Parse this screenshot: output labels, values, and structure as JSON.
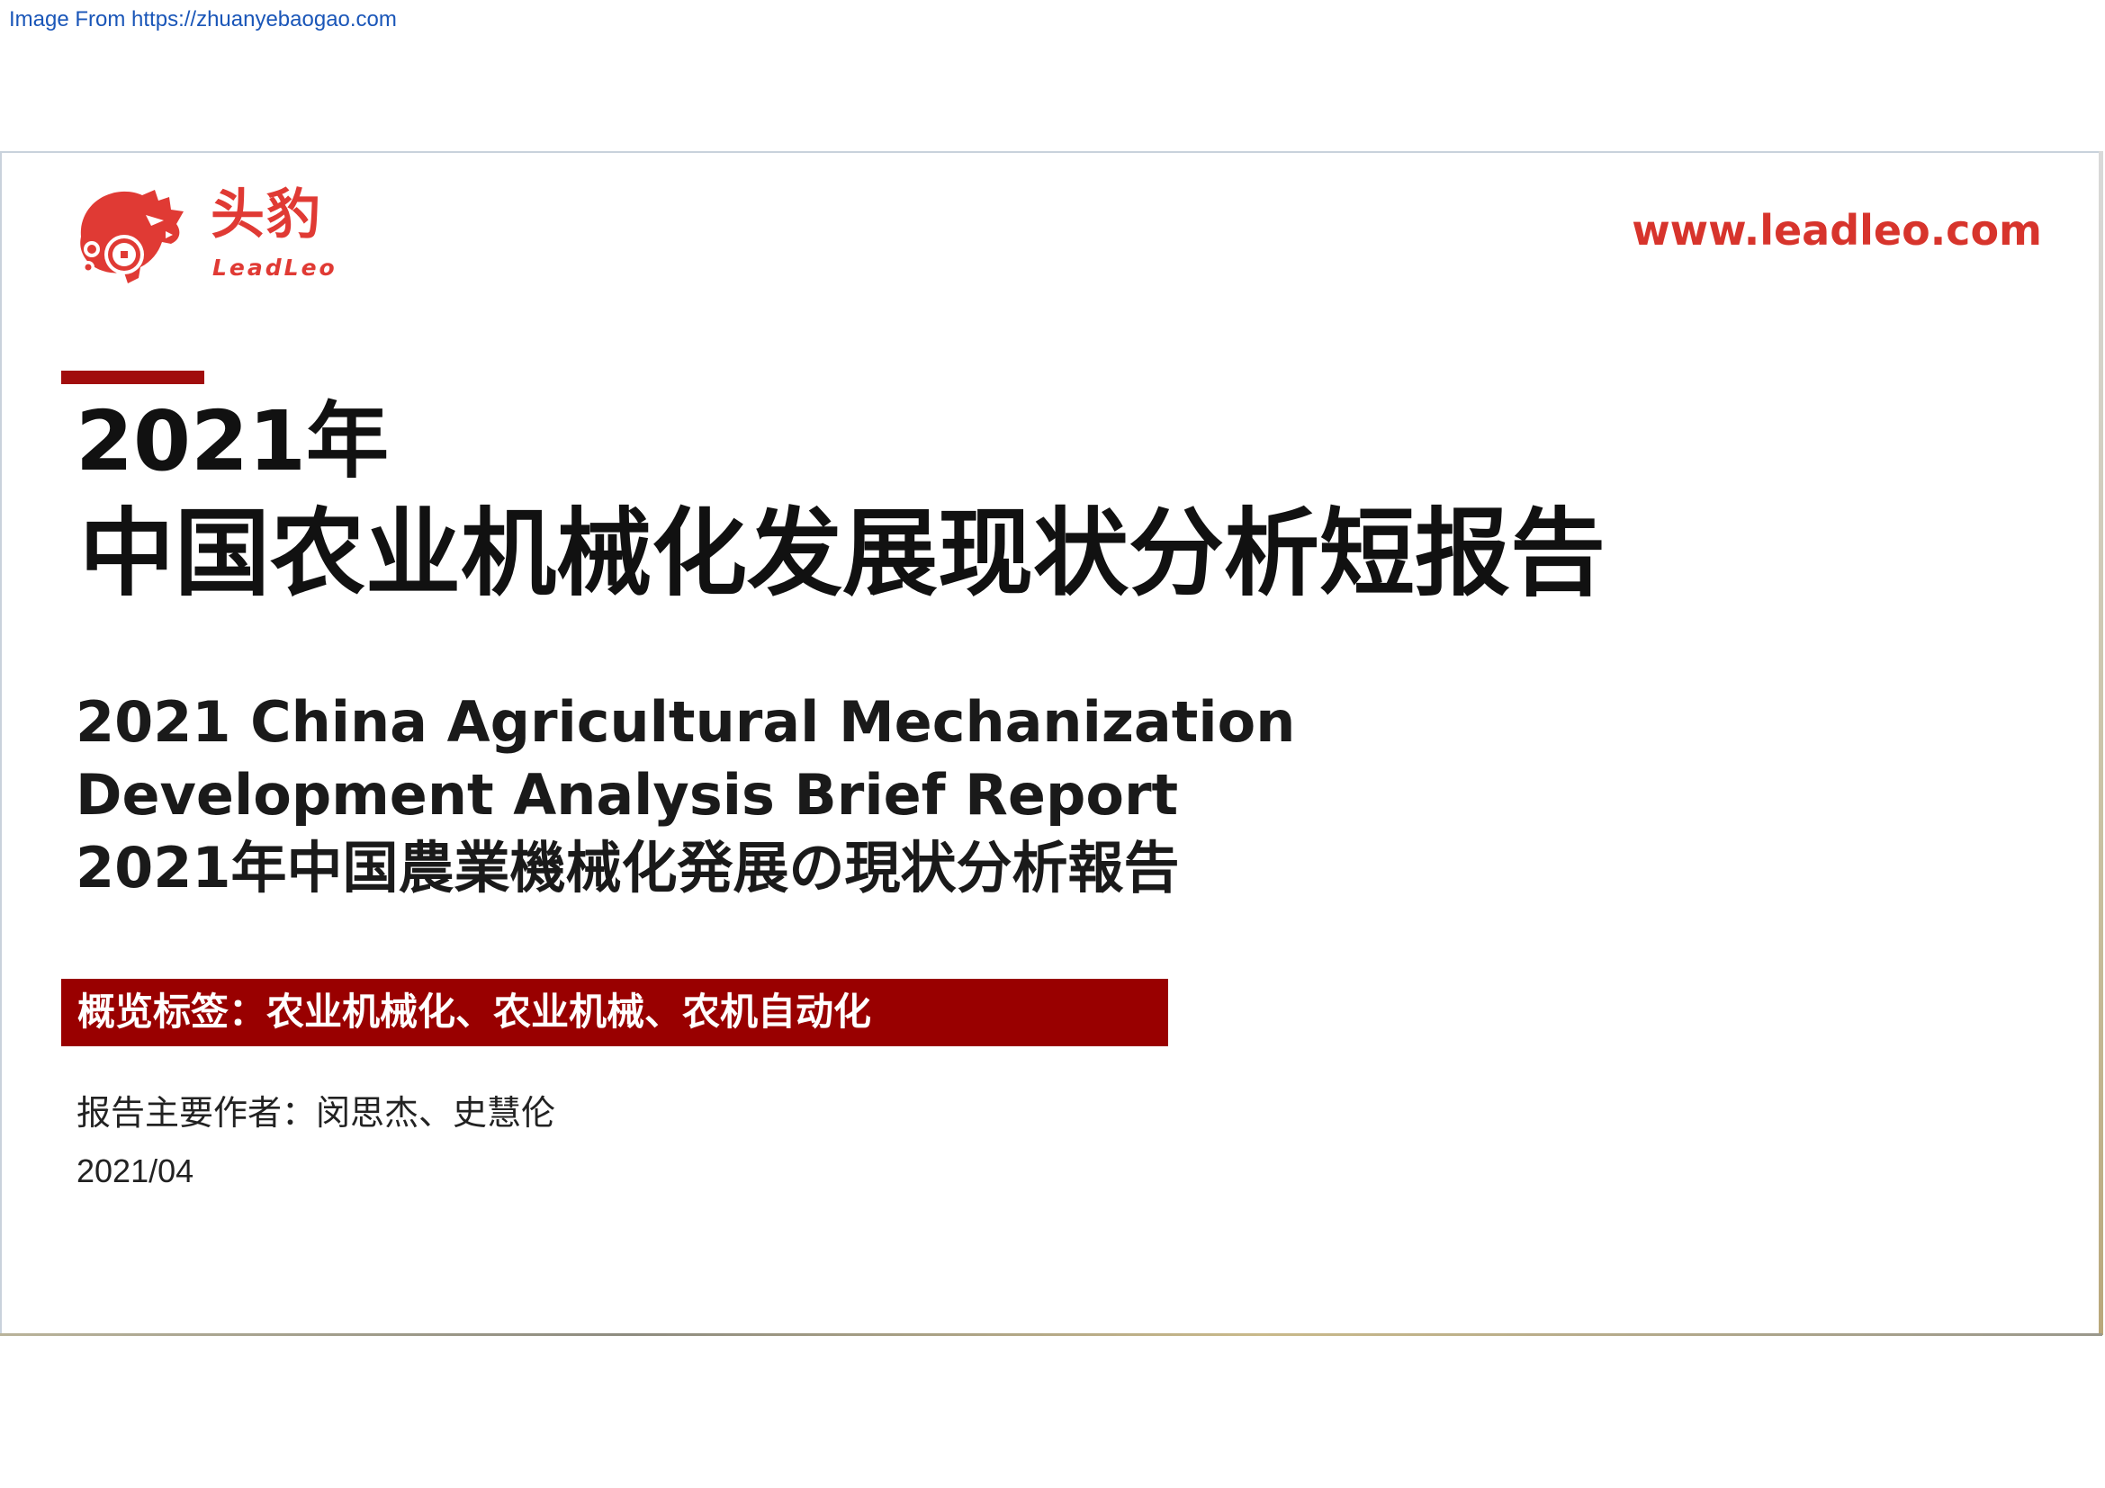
{
  "source_link": "Image From https://zhuanyebaogao.com",
  "logo": {
    "name_cn": "头豹",
    "name_en": "LeadLeo",
    "brand_color": "#e03a34",
    "icon": "leopard-head-icon"
  },
  "site_url": "www.leadleo.com",
  "title": {
    "year": "2021年",
    "main": "中国农业机械化发展现状分析短报告"
  },
  "subtitles": [
    "2021 China Agricultural Mechanization",
    "Development Analysis Brief Report",
    "2021年中国農業機械化発展の現状分析報告"
  ],
  "tag_banner": {
    "text": "概览标签：农业机械化、农业机械、农机自动化",
    "background": "#990000"
  },
  "authors": "报告主要作者：闵思杰、史慧伦",
  "date": "2021/04",
  "colors": {
    "accent": "#a10d0d",
    "url": "#d7342c"
  }
}
